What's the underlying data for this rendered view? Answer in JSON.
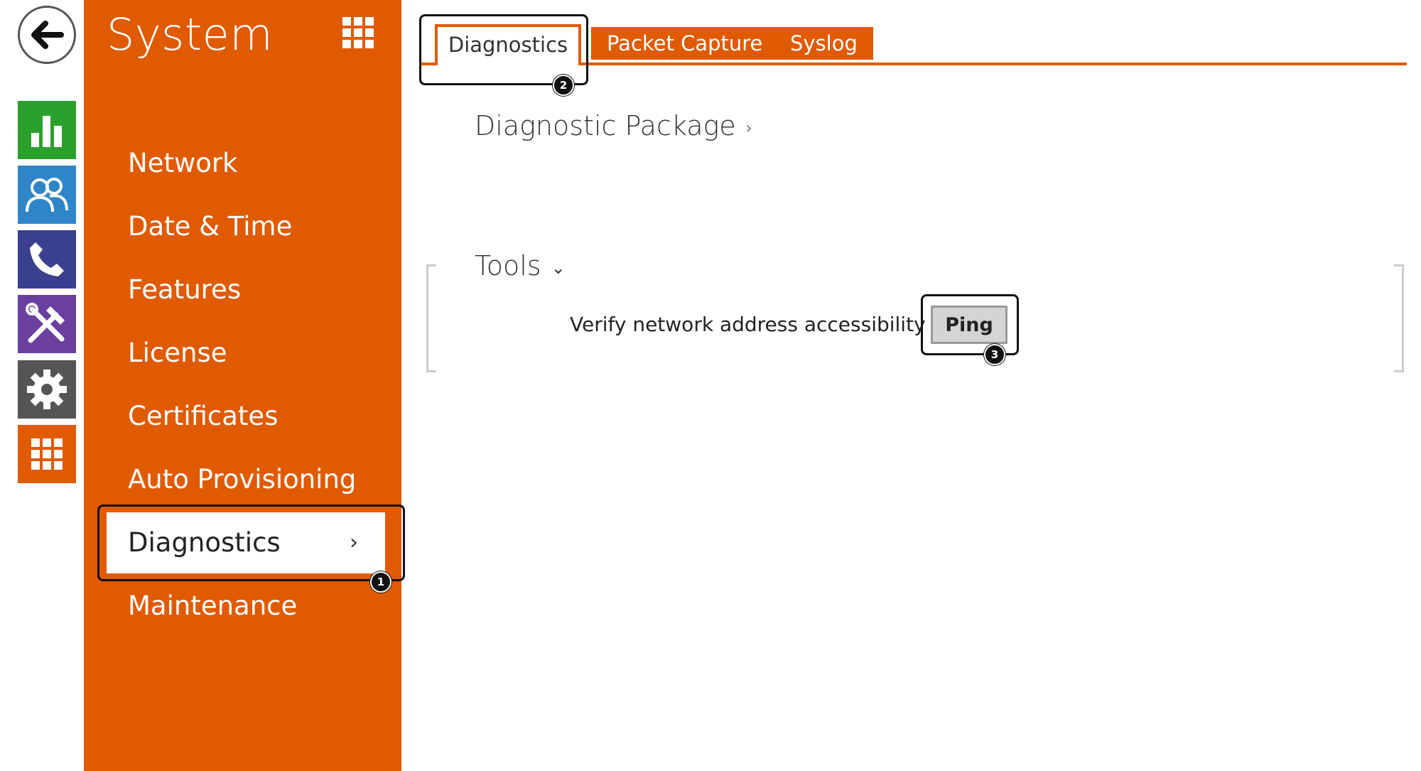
{
  "rail": {
    "back_icon": "arrow-left-icon",
    "tiles": [
      {
        "name": "status",
        "icon": "bar-chart-icon",
        "color": "#2ca02c"
      },
      {
        "name": "directory",
        "icon": "users-icon",
        "color": "#2e86c8"
      },
      {
        "name": "calls",
        "icon": "phone-icon",
        "color": "#3a3f8f"
      },
      {
        "name": "hardware",
        "icon": "tools-icon",
        "color": "#6a3fa0"
      },
      {
        "name": "services",
        "icon": "gear-icon",
        "color": "#555555"
      },
      {
        "name": "system",
        "icon": "grid-icon",
        "color": "#e05a00"
      }
    ]
  },
  "sidebar": {
    "title": "System",
    "accent": "#e05a00",
    "items": [
      {
        "label": "Network"
      },
      {
        "label": "Date & Time"
      },
      {
        "label": "Features"
      },
      {
        "label": "License"
      },
      {
        "label": "Certificates"
      },
      {
        "label": "Auto Provisioning"
      },
      {
        "label": "Diagnostics",
        "active": true,
        "chevron": "›"
      },
      {
        "label": "Maintenance"
      }
    ]
  },
  "tabs": [
    {
      "label": "Diagnostics",
      "active": true
    },
    {
      "label": "Packet Capture"
    },
    {
      "label": "Syslog"
    }
  ],
  "content": {
    "diagnostic_package": {
      "title": "Diagnostic Package",
      "chevron": "›"
    },
    "tools": {
      "title": "Tools",
      "chevron": "⌄",
      "row_label": "Verify network address accessibility",
      "button_label": "Ping"
    }
  },
  "callouts": {
    "one": "1",
    "two": "2",
    "three": "3"
  }
}
